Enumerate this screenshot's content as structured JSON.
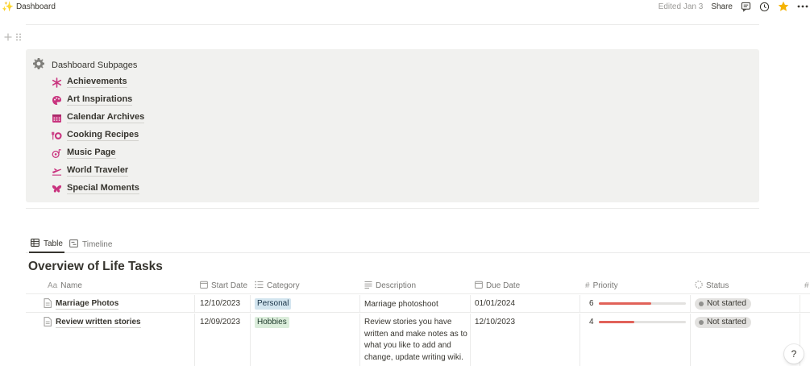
{
  "topbar": {
    "breadcrumb": "Dashboard",
    "edited": "Edited Jan 3",
    "share": "Share"
  },
  "callout": {
    "title": "Dashboard Subpages",
    "items": [
      {
        "label": "Achievements",
        "icon": "asterisk-icon"
      },
      {
        "label": "Art Inspirations",
        "icon": "palette-icon"
      },
      {
        "label": "Calendar Archives",
        "icon": "calendar-icon"
      },
      {
        "label": "Cooking Recipes",
        "icon": "utensils-icon"
      },
      {
        "label": "Music Page",
        "icon": "music-icon"
      },
      {
        "label": "World Traveler",
        "icon": "airplane-icon"
      },
      {
        "label": "Special Moments",
        "icon": "butterfly-icon"
      }
    ],
    "icon_color": "#c9347f"
  },
  "views": {
    "tabs": [
      {
        "label": "Table",
        "active": true
      },
      {
        "label": "Timeline",
        "active": false
      }
    ]
  },
  "database": {
    "title": "Overview of Life Tasks",
    "columns": {
      "name": "Name",
      "name_prefix": "Aa",
      "start_date": "Start Date",
      "category": "Category",
      "description": "Description",
      "due_date": "Due Date",
      "priority": "Priority",
      "status": "Status",
      "more": "#"
    },
    "rows": [
      {
        "name": "Marriage Photos",
        "start_date": "12/10/2023",
        "category": "Personal",
        "description": "Marriage photoshoot",
        "due_date": "01/01/2024",
        "priority": "6",
        "priority_fraction": 0.6,
        "status": "Not started"
      },
      {
        "name": "Review written stories",
        "start_date": "12/09/2023",
        "category": "Hobbies",
        "description": "Review stories you have written and make notes as to what you like to add and change, update writing wiki.",
        "due_date": "12/10/2023",
        "priority": "4",
        "priority_fraction": 0.4,
        "status": "Not started"
      }
    ]
  },
  "help": "?"
}
